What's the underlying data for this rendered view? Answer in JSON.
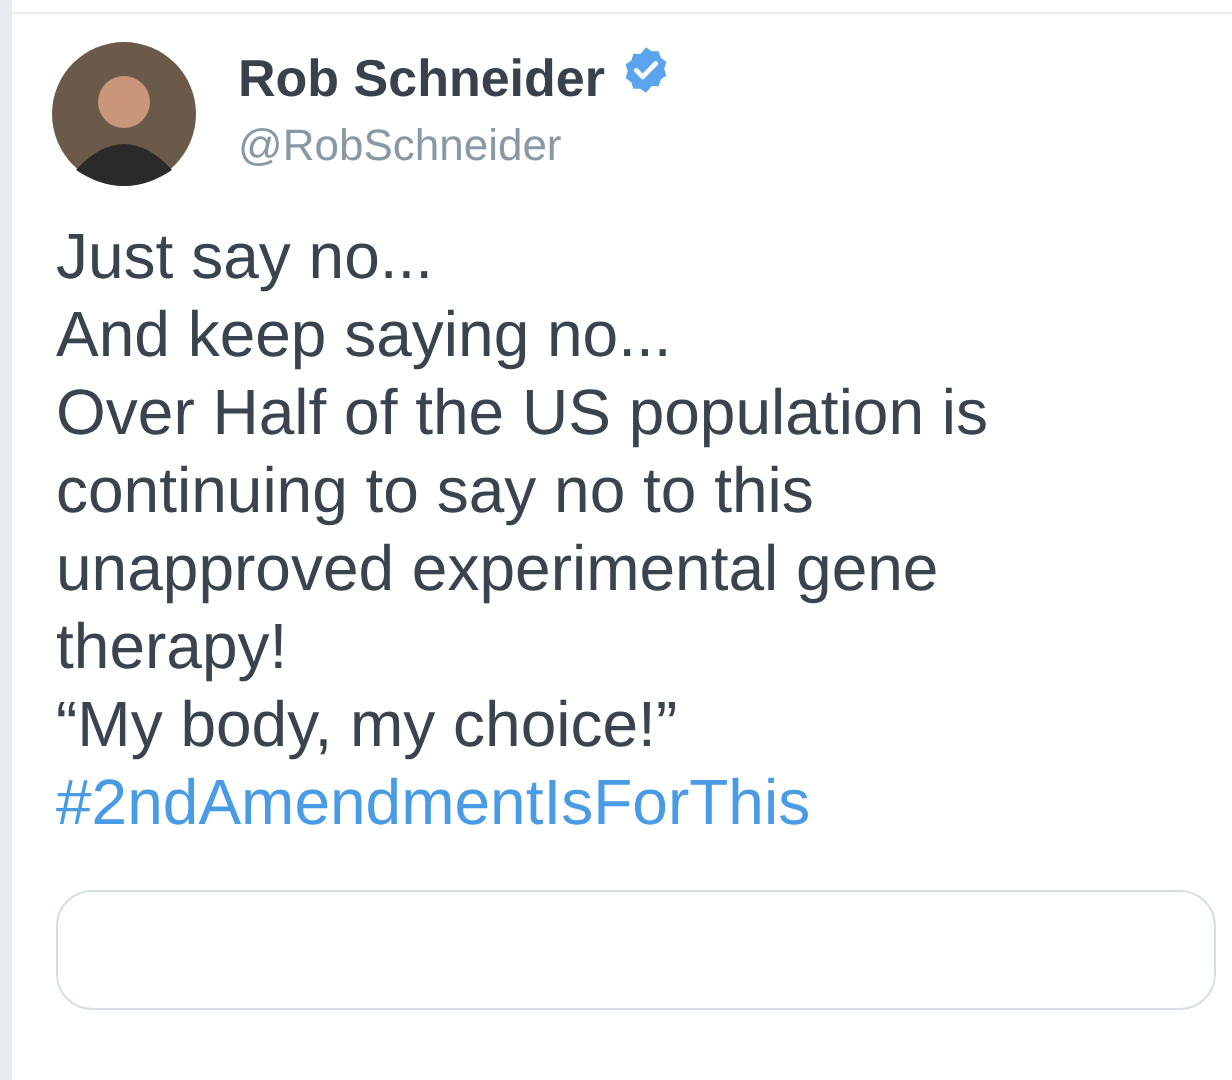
{
  "author": {
    "name": "Rob Schneider",
    "handle": "@RobSchneider",
    "verified": true
  },
  "body": "Just say no...\nAnd keep saying no...\nOver Half of the US population is continuing to say no to this unapproved experimental gene therapy!\n“My body, my choice!”",
  "hashtag": "#2ndAmendmentIsForThis"
}
